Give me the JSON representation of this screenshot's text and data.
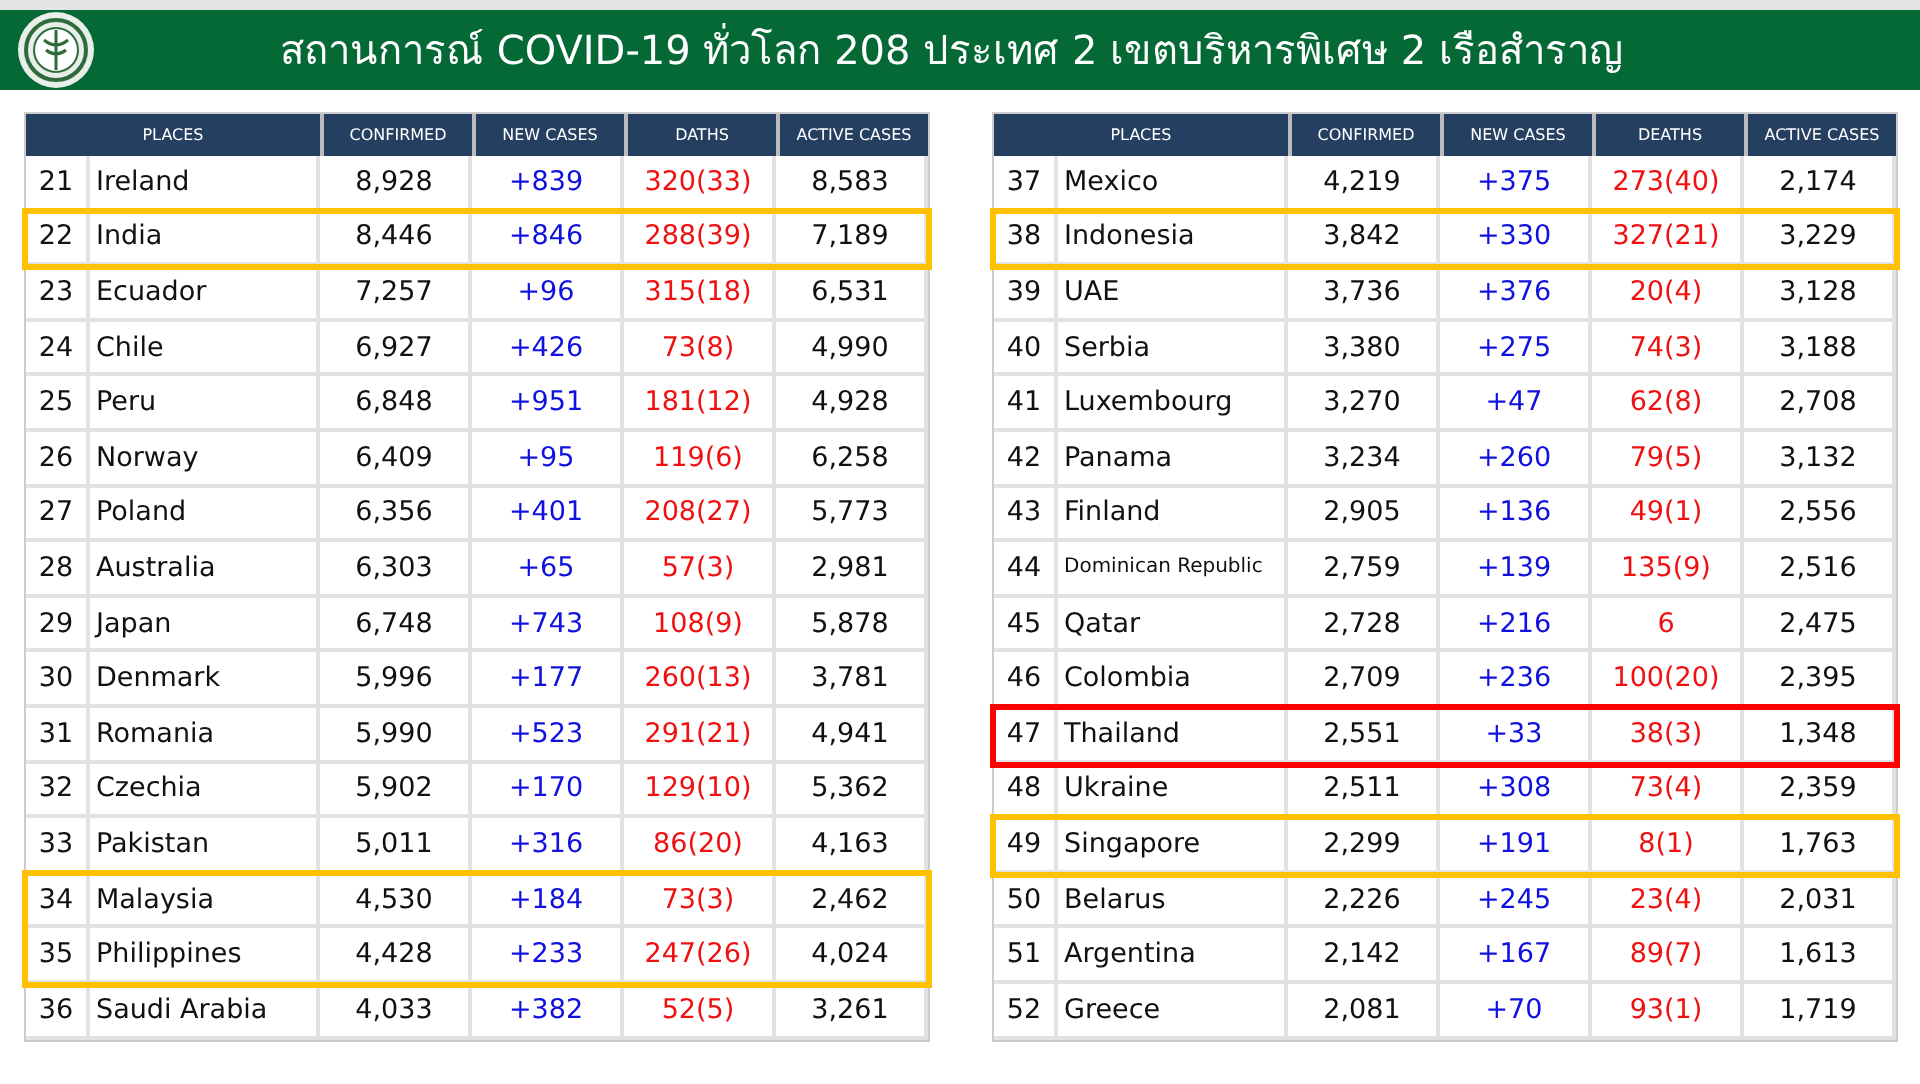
{
  "header": {
    "title": "สถานการณ์ COVID-19 ทั่วโลก 208 ประเทศ 2 เขตบริหารพิเศษ 2 เรือสำราญ"
  },
  "tables": [
    {
      "columns": [
        "PLACES",
        "CONFIRMED",
        "NEW  CASES",
        "DATHS",
        "ACTIVE CASES"
      ],
      "rows": [
        {
          "rank": "21",
          "place": "Ireland",
          "confirmed": "8,928",
          "new_cases": "+839",
          "deaths": "320(33)",
          "active": "8,583"
        },
        {
          "rank": "22",
          "place": "India",
          "confirmed": "8,446",
          "new_cases": "+846",
          "deaths": "288(39)",
          "active": "7,189",
          "color": "#ffc000"
        },
        {
          "rank": "23",
          "place": "Ecuador",
          "confirmed": "7,257",
          "new_cases": "+96",
          "deaths": "315(18)",
          "active": "6,531"
        },
        {
          "rank": "24",
          "place": "Chile",
          "confirmed": "6,927",
          "new_cases": "+426",
          "deaths": "73(8)",
          "active": "4,990"
        },
        {
          "rank": "25",
          "place": "Peru",
          "confirmed": "6,848",
          "new_cases": "+951",
          "deaths": "181(12)",
          "active": "4,928"
        },
        {
          "rank": "26",
          "place": "Norway",
          "confirmed": "6,409",
          "new_cases": "+95",
          "deaths": "119(6)",
          "active": "6,258"
        },
        {
          "rank": "27",
          "place": "Poland",
          "confirmed": "6,356",
          "new_cases": "+401",
          "deaths": "208(27)",
          "active": "5,773"
        },
        {
          "rank": "28",
          "place": "Australia",
          "confirmed": "6,303",
          "new_cases": "+65",
          "deaths": "57(3)",
          "active": "2,981"
        },
        {
          "rank": "29",
          "place": "Japan",
          "confirmed": "6,748",
          "new_cases": "+743",
          "deaths": "108(9)",
          "active": "5,878"
        },
        {
          "rank": "30",
          "place": "Denmark",
          "confirmed": "5,996",
          "new_cases": "+177",
          "deaths": "260(13)",
          "active": "3,781"
        },
        {
          "rank": "31",
          "place": "Romania",
          "confirmed": "5,990",
          "new_cases": "+523",
          "deaths": "291(21)",
          "active": "4,941"
        },
        {
          "rank": "32",
          "place": "Czechia",
          "confirmed": "5,902",
          "new_cases": "+170",
          "deaths": "129(10)",
          "active": "5,362"
        },
        {
          "rank": "33",
          "place": "Pakistan",
          "confirmed": "5,011",
          "new_cases": "+316",
          "deaths": "86(20)",
          "active": "4,163"
        },
        {
          "rank": "34",
          "place": "Malaysia",
          "confirmed": "4,530",
          "new_cases": "+184",
          "deaths": "73(3)",
          "active": "2,462",
          "color": "#ffc000"
        },
        {
          "rank": "35",
          "place": "Philippines",
          "confirmed": "4,428",
          "new_cases": "+233",
          "deaths": "247(26)",
          "active": "4,024",
          "color": "#ffc000"
        },
        {
          "rank": "36",
          "place": "Saudi Arabia",
          "confirmed": "4,033",
          "new_cases": "+382",
          "deaths": "52(5)",
          "active": "3,261"
        }
      ]
    },
    {
      "columns": [
        "PLACES",
        "CONFIRMED",
        "NEW  CASES",
        "DEATHS",
        "ACTIVE CASES"
      ],
      "rows": [
        {
          "rank": "37",
          "place": "Mexico",
          "confirmed": "4,219",
          "new_cases": "+375",
          "deaths": "273(40)",
          "active": "2,174"
        },
        {
          "rank": "38",
          "place": "Indonesia",
          "confirmed": "3,842",
          "new_cases": "+330",
          "deaths": "327(21)",
          "active": "3,229",
          "color": "#ffc000"
        },
        {
          "rank": "39",
          "place": "UAE",
          "confirmed": "3,736",
          "new_cases": "+376",
          "deaths": "20(4)",
          "active": "3,128"
        },
        {
          "rank": "40",
          "place": "Serbia",
          "confirmed": "3,380",
          "new_cases": "+275",
          "deaths": "74(3)",
          "active": "3,188"
        },
        {
          "rank": "41",
          "place": "Luxembourg",
          "confirmed": "3,270",
          "new_cases": "+47",
          "deaths": "62(8)",
          "active": "2,708"
        },
        {
          "rank": "42",
          "place": "Panama",
          "confirmed": "3,234",
          "new_cases": "+260",
          "deaths": "79(5)",
          "active": "3,132"
        },
        {
          "rank": "43",
          "place": "Finland",
          "confirmed": "2,905",
          "new_cases": "+136",
          "deaths": "49(1)",
          "active": "2,556"
        },
        {
          "rank": "44",
          "place": "Dominican Republic",
          "confirmed": "2,759",
          "new_cases": "+139",
          "deaths": "135(9)",
          "active": "2,516",
          "small": true
        },
        {
          "rank": "45",
          "place": "Qatar",
          "confirmed": "2,728",
          "new_cases": "+216",
          "deaths": "6",
          "active": "2,475"
        },
        {
          "rank": "46",
          "place": "Colombia",
          "confirmed": "2,709",
          "new_cases": "+236",
          "deaths": "100(20)",
          "active": "2,395"
        },
        {
          "rank": "47",
          "place": "Thailand",
          "confirmed": "2,551",
          "new_cases": "+33",
          "deaths": "38(3)",
          "active": "1,348",
          "color": "#ff0000"
        },
        {
          "rank": "48",
          "place": "Ukraine",
          "confirmed": "2,511",
          "new_cases": "+308",
          "deaths": "73(4)",
          "active": "2,359"
        },
        {
          "rank": "49",
          "place": "Singapore",
          "confirmed": "2,299",
          "new_cases": "+191",
          "deaths": "8(1)",
          "active": "1,763",
          "color": "#ffc000"
        },
        {
          "rank": "50",
          "place": "Belarus",
          "confirmed": "2,226",
          "new_cases": "+245",
          "deaths": "23(4)",
          "active": "2,031"
        },
        {
          "rank": "51",
          "place": "Argentina",
          "confirmed": "2,142",
          "new_cases": "+167",
          "deaths": "89(7)",
          "active": "1,613"
        },
        {
          "rank": "52",
          "place": "Greece",
          "confirmed": "2,081",
          "new_cases": "+70",
          "deaths": "93(1)",
          "active": "1,719"
        }
      ]
    }
  ]
}
